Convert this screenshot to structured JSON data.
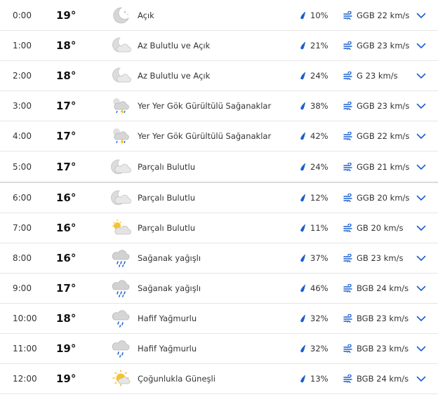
{
  "hours": [
    {
      "time": "0:00",
      "temp": "19°",
      "icon": "moon-clear-icon",
      "cond": "Açık",
      "rain": "10%",
      "wind": "GGB 22 km/s"
    },
    {
      "time": "1:00",
      "temp": "18°",
      "icon": "moon-partly-cloudy-icon",
      "cond": "Az Bulutlu ve Açık",
      "rain": "21%",
      "wind": "GGB 23 km/s"
    },
    {
      "time": "2:00",
      "temp": "18°",
      "icon": "moon-partly-cloudy-icon",
      "cond": "Az Bulutlu ve Açık",
      "rain": "24%",
      "wind": "G 23 km/s"
    },
    {
      "time": "3:00",
      "temp": "17°",
      "icon": "thunderstorm-icon",
      "cond": "Yer Yer Gök Gürültülü Sağanaklar",
      "rain": "38%",
      "wind": "GGB 23 km/s"
    },
    {
      "time": "4:00",
      "temp": "17°",
      "icon": "thunderstorm-icon",
      "cond": "Yer Yer Gök Gürültülü Sağanaklar",
      "rain": "42%",
      "wind": "GGB 22 km/s"
    },
    {
      "time": "5:00",
      "temp": "17°",
      "icon": "moon-cloudy-icon",
      "cond": "Parçalı Bulutlu",
      "rain": "24%",
      "wind": "GGB 21 km/s"
    },
    {
      "time": "6:00",
      "temp": "16°",
      "icon": "moon-cloudy-icon",
      "cond": "Parçalı Bulutlu",
      "rain": "12%",
      "wind": "GGB 20 km/s"
    },
    {
      "time": "7:00",
      "temp": "16°",
      "icon": "sun-cloudy-icon",
      "cond": "Parçalı Bulutlu",
      "rain": "11%",
      "wind": "GB 20 km/s"
    },
    {
      "time": "8:00",
      "temp": "16°",
      "icon": "rain-shower-icon",
      "cond": "Sağanak yağışlı",
      "rain": "37%",
      "wind": "GB 23 km/s"
    },
    {
      "time": "9:00",
      "temp": "17°",
      "icon": "rain-shower-icon",
      "cond": "Sağanak yağışlı",
      "rain": "46%",
      "wind": "BGB 24 km/s"
    },
    {
      "time": "10:00",
      "temp": "18°",
      "icon": "light-rain-icon",
      "cond": "Hafif Yağmurlu",
      "rain": "32%",
      "wind": "BGB 23 km/s"
    },
    {
      "time": "11:00",
      "temp": "19°",
      "icon": "light-rain-icon",
      "cond": "Hafif Yağmurlu",
      "rain": "32%",
      "wind": "BGB 23 km/s"
    },
    {
      "time": "12:00",
      "temp": "19°",
      "icon": "mostly-sunny-icon",
      "cond": "Çoğunlukla Güneşli",
      "rain": "13%",
      "wind": "BGB 24 km/s"
    }
  ],
  "colors": {
    "accent": "#1a5fd0",
    "icon_grey": "#b8b8b8",
    "sun": "#f4c430",
    "bolt": "#f2b600"
  }
}
